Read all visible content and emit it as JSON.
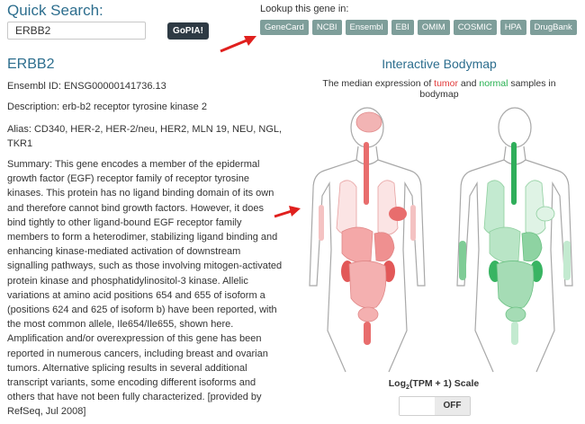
{
  "search": {
    "title": "Quick Search:",
    "value": "ERBB2",
    "button_label": "GoPIA!"
  },
  "lookup": {
    "label": "Lookup this gene in:",
    "databases": [
      "GeneCard",
      "NCBI",
      "Ensembl",
      "EBI",
      "OMIM",
      "COSMIC",
      "HPA",
      "DrugBank"
    ]
  },
  "gene": {
    "name": "ERBB2",
    "ensembl_id": "Ensembl ID: ENSG00000141736.13",
    "description": "Description: erb-b2 receptor tyrosine kinase 2",
    "alias": "Alias: CD340, HER-2, HER-2/neu, HER2, MLN 19, NEU, NGL, TKR1",
    "summary": "Summary: This gene encodes a member of the epidermal growth factor (EGF) receptor family of receptor tyrosine kinases. This protein has no ligand binding domain of its own and therefore cannot bind growth factors. However, it does bind tightly to other ligand-bound EGF receptor family members to form a heterodimer, stabilizing ligand binding and enhancing kinase-mediated activation of downstream signalling pathways, such as those involving mitogen-activated protein kinase and phosphatidylinositol-3 kinase. Allelic variations at amino acid positions 654 and 655 of isoform a (positions 624 and 625 of isoform b) have been reported, with the most common allele, Ile654/Ile655, shown here. Amplification and/or overexpression of this gene has been reported in numerous cancers, including breast and ovarian tumors. Alternative splicing results in several additional transcript variants, some encoding different isoforms and others that have not been fully characterized. [provided by RefSeq, Jul 2008]"
  },
  "bodymap": {
    "title": "Interactive Bodymap",
    "subtitle_prefix": "The median expression of ",
    "tumor_word": "tumor",
    "subtitle_mid": " and ",
    "normal_word": "normal",
    "subtitle_suffix": " samples in bodymap",
    "tumor_color": "#e23a3a",
    "normal_color": "#25b04f",
    "scale_label_prefix": "Log",
    "scale_label_sub": "2",
    "scale_label_suffix": "(TPM + 1) Scale",
    "toggle_label": "OFF"
  },
  "colors": {
    "heading": "#2d6e8e",
    "db_button": "#7e9e9a",
    "go_button": "#2e3a44",
    "annotation_arrow": "#e0201e"
  },
  "icons": [
    "red-arrow-icon",
    "tumor-body-figure",
    "normal-body-figure"
  ]
}
